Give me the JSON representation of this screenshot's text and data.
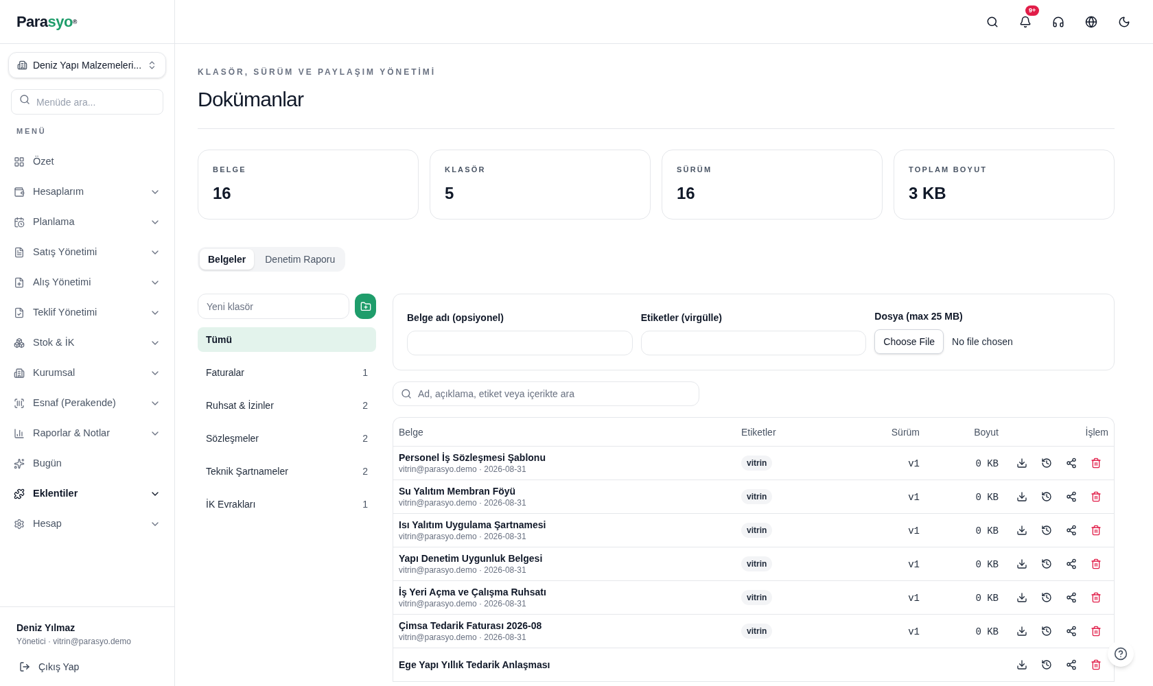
{
  "brand": {
    "name": "Para",
    "accent": "syo",
    "mark": "®"
  },
  "company_selector": {
    "label": "Deniz Yapı Malzemeleri..."
  },
  "menu_search": {
    "placeholder": "Menüde ara..."
  },
  "menu_heading": "MENÜ",
  "menu_items": [
    {
      "label": "Özet",
      "kind": "link",
      "selected": false
    },
    {
      "label": "Hesaplarım",
      "kind": "group",
      "selected": false
    },
    {
      "label": "Planlama",
      "kind": "group",
      "selected": false
    },
    {
      "label": "Satış Yönetimi",
      "kind": "group",
      "selected": false
    },
    {
      "label": "Alış Yönetimi",
      "kind": "group",
      "selected": false
    },
    {
      "label": "Teklif Yönetimi",
      "kind": "group",
      "selected": false
    },
    {
      "label": "Stok & İK",
      "kind": "group",
      "selected": false
    },
    {
      "label": "Kurumsal",
      "kind": "group",
      "selected": false
    },
    {
      "label": "Esnaf (Perakende)",
      "kind": "group",
      "selected": false
    },
    {
      "label": "Raporlar & Notlar",
      "kind": "group",
      "selected": false
    },
    {
      "label": "Bugün",
      "kind": "link",
      "selected": false
    },
    {
      "label": "Eklentiler",
      "kind": "group",
      "selected": true
    },
    {
      "label": "Hesap",
      "kind": "group",
      "selected": false
    }
  ],
  "user": {
    "name": "Deniz Yılmaz",
    "detail": "Yönetici · vitrin@parasyo.demo"
  },
  "logout": "Çıkış Yap",
  "header": {
    "notification_badge": "9+"
  },
  "page": {
    "eyebrow": "KLASÖR, SÜRÜM VE PAYLAŞIM YÖNETİMİ",
    "title": "Dokümanlar"
  },
  "stats": [
    {
      "label": "BELGE",
      "value": "16"
    },
    {
      "label": "KLASÖR",
      "value": "5"
    },
    {
      "label": "SÜRÜM",
      "value": "16"
    },
    {
      "label": "TOPLAM BOYUT",
      "value": "3 KB"
    }
  ],
  "tabs": [
    {
      "label": "Belgeler",
      "selected": true
    },
    {
      "label": "Denetim Raporu",
      "selected": false
    }
  ],
  "new_folder": {
    "placeholder": "Yeni klasör"
  },
  "folders": [
    {
      "name": "Tümü",
      "selected": true
    },
    {
      "name": "Faturalar",
      "count": "1",
      "selected": false
    },
    {
      "name": "Ruhsat & İzinler",
      "count": "2",
      "selected": false
    },
    {
      "name": "Sözleşmeler",
      "count": "2",
      "selected": false
    },
    {
      "name": "Teknik Şartnameler",
      "count": "2",
      "selected": false
    },
    {
      "name": "İK Evrakları",
      "count": "1",
      "selected": false
    }
  ],
  "upload": {
    "fields": [
      {
        "label": "Belge adı (opsiyonel)",
        "kind": "text"
      },
      {
        "label": "Etiketler (virgülle)",
        "kind": "text"
      },
      {
        "label": "Dosya (max 25 MB)",
        "kind": "file",
        "button": "Choose File",
        "status": "No file chosen"
      }
    ]
  },
  "doc_search": {
    "placeholder": "Ad, açıklama, etiket veya içerikte ara"
  },
  "table": {
    "columns": [
      "Belge",
      "Etiketler",
      "Sürüm",
      "Boyut",
      "İşlem"
    ],
    "rows": [
      {
        "name": "Personel İş Sözleşmesi Şablonu",
        "meta": "vitrin@parasyo.demo · 2026-08-31",
        "tags": [
          "vitrin"
        ],
        "version": "v1",
        "size": "0 KB"
      },
      {
        "name": "Su Yalıtım Membran Föyü",
        "meta": "vitrin@parasyo.demo · 2026-08-31",
        "tags": [
          "vitrin"
        ],
        "version": "v1",
        "size": "0 KB"
      },
      {
        "name": "Isı Yalıtım Uygulama Şartnamesi",
        "meta": "vitrin@parasyo.demo · 2026-08-31",
        "tags": [
          "vitrin"
        ],
        "version": "v1",
        "size": "0 KB"
      },
      {
        "name": "Yapı Denetim Uygunluk Belgesi",
        "meta": "vitrin@parasyo.demo · 2026-08-31",
        "tags": [
          "vitrin"
        ],
        "version": "v1",
        "size": "0 KB"
      },
      {
        "name": "İş Yeri Açma ve Çalışma Ruhsatı",
        "meta": "vitrin@parasyo.demo · 2026-08-31",
        "tags": [
          "vitrin"
        ],
        "version": "v1",
        "size": "0 KB"
      },
      {
        "name": "Çimsa Tedarik Faturası 2026-08",
        "meta": "vitrin@parasyo.demo · 2026-08-31",
        "tags": [
          "vitrin"
        ],
        "version": "v1",
        "size": "0 KB"
      },
      {
        "name": "Ege Yapı Yıllık Tedarik Anlaşması"
      }
    ]
  }
}
